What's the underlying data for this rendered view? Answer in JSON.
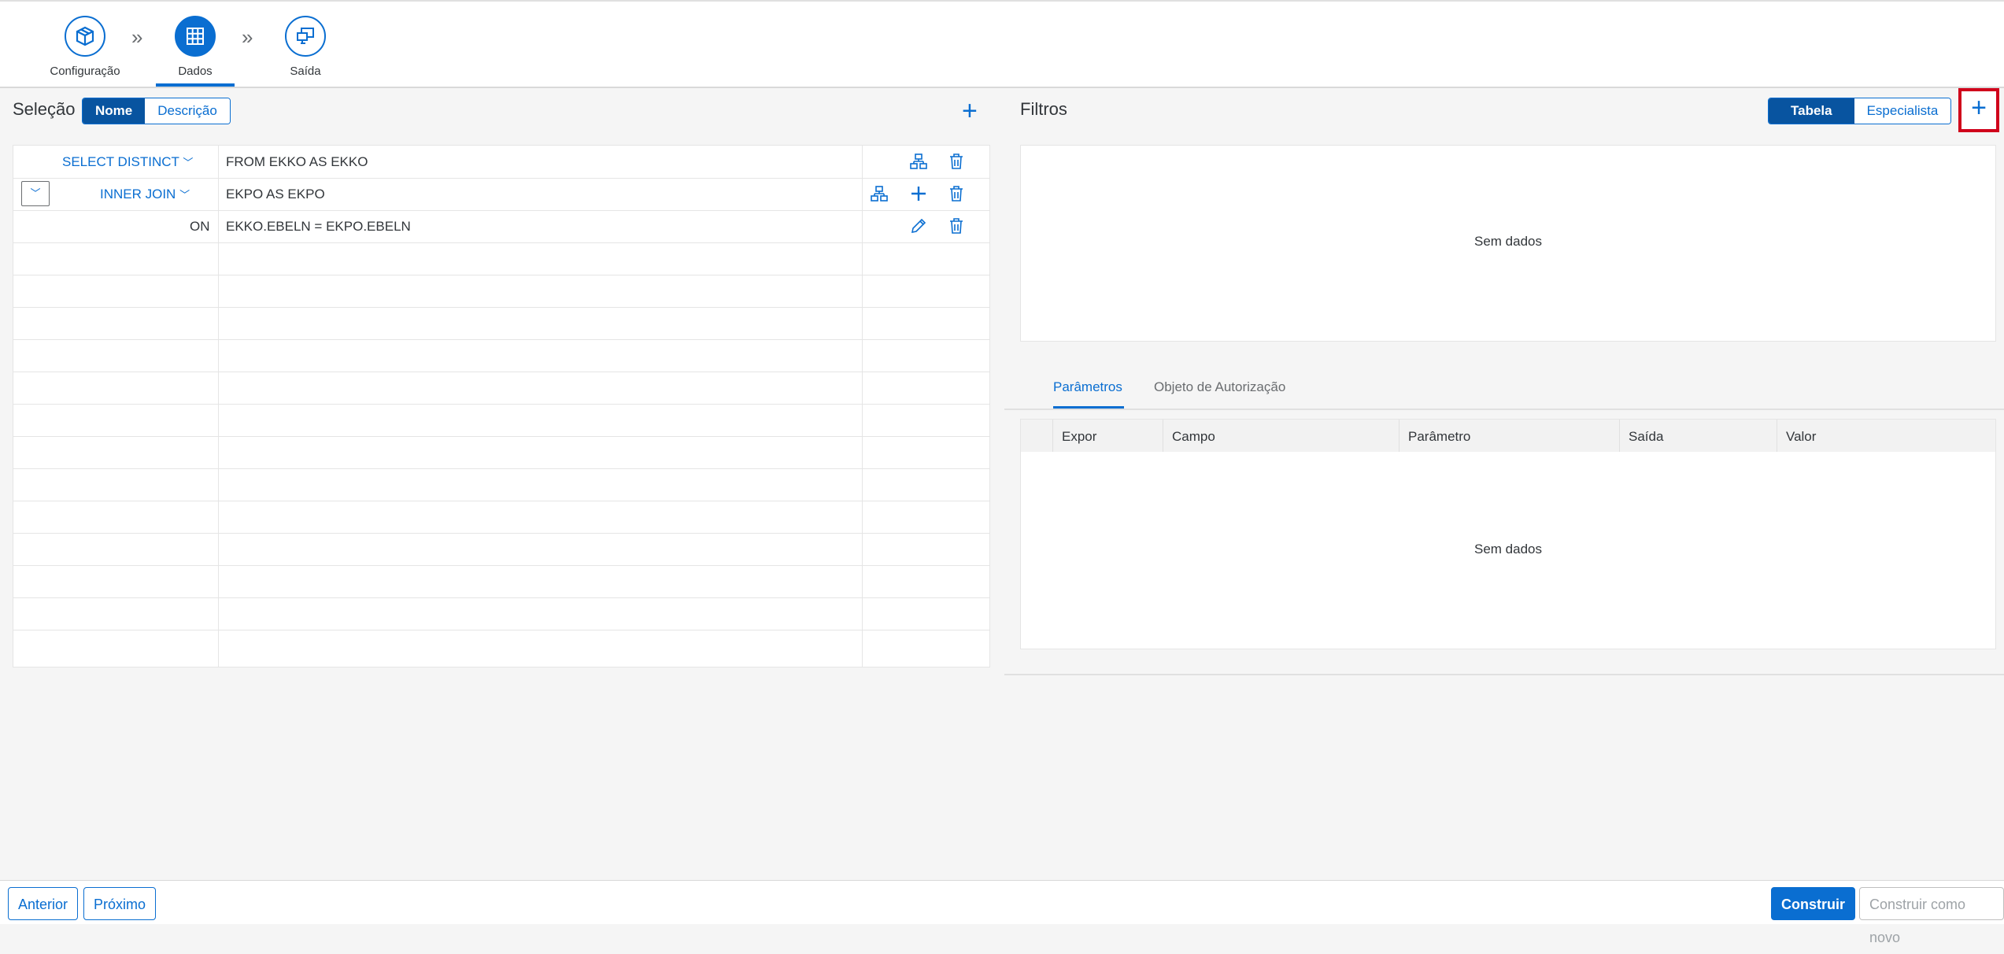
{
  "wizard": {
    "steps": [
      {
        "label": "Configuração",
        "icon": "package-icon"
      },
      {
        "label": "Dados",
        "icon": "grid-icon"
      },
      {
        "label": "Saída",
        "icon": "monitor-icon"
      }
    ],
    "active_step": "Dados"
  },
  "selecao": {
    "title": "Seleção",
    "toggle": {
      "nome": "Nome",
      "descricao": "Descrição",
      "selected": "Nome"
    },
    "rows": [
      {
        "keyword": "SELECT DISTINCT",
        "text": "FROM EKKO AS EKKO",
        "actions": [
          "hierarchy-icon",
          "trash-icon"
        ]
      },
      {
        "keyword": "INNER JOIN",
        "text": "EKPO AS EKPO",
        "actions": [
          "hierarchy-icon",
          "plus-icon",
          "trash-icon"
        ]
      },
      {
        "keyword": "ON",
        "text": "EKKO.EBELN = EKPO.EBELN",
        "actions": [
          "pencil-icon",
          "trash-icon"
        ]
      }
    ]
  },
  "filtros": {
    "title": "Filtros",
    "toggle": {
      "tabela": "Tabela",
      "especialista": "Especialista",
      "selected": "Tabela"
    },
    "empty": "Sem dados"
  },
  "tabs": {
    "parametros": "Parâmetros",
    "objeto": "Objeto de Autorização",
    "selected": "Parâmetros"
  },
  "param_table": {
    "columns": [
      "Expor",
      "Campo",
      "Parâmetro",
      "Saída",
      "Valor"
    ],
    "empty": "Sem dados"
  },
  "footer": {
    "anterior": "Anterior",
    "proximo": "Próximo",
    "construir": "Construir",
    "construir_novo": "Construir como novo"
  },
  "colors": {
    "accent": "#0a6ed1",
    "accent_dark": "#0854a0",
    "highlight": "#d0021b"
  }
}
